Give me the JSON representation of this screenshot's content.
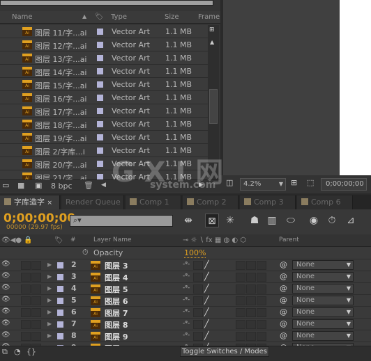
{
  "project": {
    "columns": {
      "name": "Name",
      "type": "Type",
      "size": "Size",
      "frame": "Frame"
    },
    "items": [
      {
        "name": "图层 11/字...ai",
        "type": "Vector Art",
        "size": "1.1 MB"
      },
      {
        "name": "图层 12/字...ai",
        "type": "Vector Art",
        "size": "1.1 MB"
      },
      {
        "name": "图层 13/字...ai",
        "type": "Vector Art",
        "size": "1.1 MB"
      },
      {
        "name": "图层 14/字...ai",
        "type": "Vector Art",
        "size": "1.1 MB"
      },
      {
        "name": "图层 15/字...ai",
        "type": "Vector Art",
        "size": "1.1 MB"
      },
      {
        "name": "图层 16/字...ai",
        "type": "Vector Art",
        "size": "1.1 MB"
      },
      {
        "name": "图层 17/字...ai",
        "type": "Vector Art",
        "size": "1.1 MB"
      },
      {
        "name": "图层 18/字...ai",
        "type": "Vector Art",
        "size": "1.1 MB"
      },
      {
        "name": "图层 19/字...ai",
        "type": "Vector Art",
        "size": "1.1 MB"
      },
      {
        "name": "图层 2/字库...i",
        "type": "Vector Art",
        "size": "1.1 MB"
      },
      {
        "name": "图层 20/字...ai",
        "type": "Vector Art",
        "size": "1.1 MB"
      },
      {
        "name": "图层 21/字...ai",
        "type": "Vector Art",
        "size": "1.1 MB"
      }
    ],
    "bpc": "8 bpc"
  },
  "viewer": {
    "zoom": "4.2%",
    "timecode": "0;00;00;00"
  },
  "tabs": [
    {
      "label": "字库造字",
      "active": true
    },
    {
      "label": "Render Queue"
    },
    {
      "label": "Comp 1"
    },
    {
      "label": "Comp 2"
    },
    {
      "label": "Comp 3"
    },
    {
      "label": "Comp 6"
    }
  ],
  "timeline": {
    "timecode": "0;00;00;00",
    "fps": "00000 (29.97 fps)",
    "columns": {
      "num": "#",
      "layer_name": "Layer Name",
      "parent": "Parent"
    },
    "property": {
      "name": "Opacity",
      "value": "100%"
    },
    "layers": [
      {
        "num": "2",
        "name": "图层 3",
        "parent": "None"
      },
      {
        "num": "3",
        "name": "图层 4",
        "parent": "None"
      },
      {
        "num": "4",
        "name": "图层 5",
        "parent": "None"
      },
      {
        "num": "5",
        "name": "图层 6",
        "parent": "None"
      },
      {
        "num": "6",
        "name": "图层 7",
        "parent": "None"
      },
      {
        "num": "7",
        "name": "图层 8",
        "parent": "None"
      },
      {
        "num": "8",
        "name": "图层 9",
        "parent": "None"
      },
      {
        "num": "9",
        "name": "图层 10",
        "parent": "None"
      }
    ],
    "toggle_label": "Toggle Switches / Modes"
  },
  "watermark": {
    "text": "GXI网",
    "sub": "system.com"
  },
  "colors": {
    "timecode": "#e0a020",
    "label": "#b4b4d8"
  }
}
